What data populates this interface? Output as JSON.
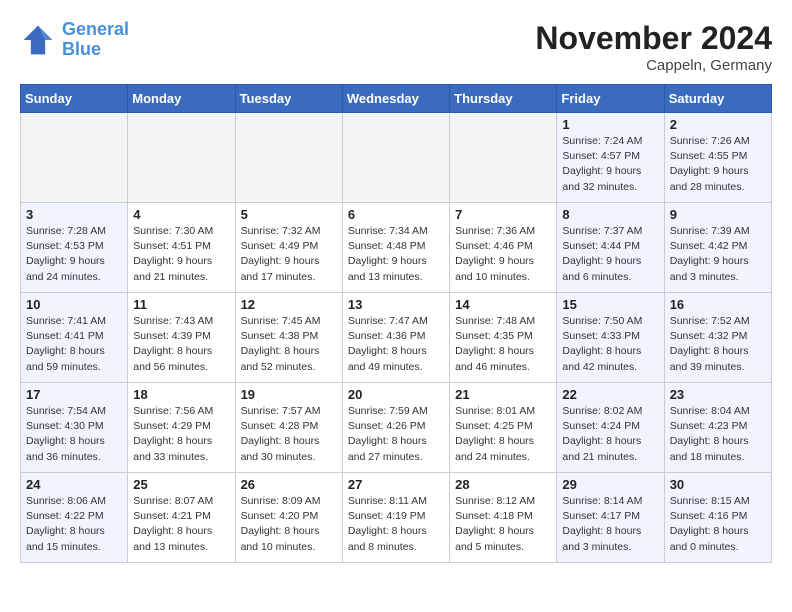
{
  "header": {
    "logo_line1": "General",
    "logo_line2": "Blue",
    "month_title": "November 2024",
    "location": "Cappeln, Germany"
  },
  "weekdays": [
    "Sunday",
    "Monday",
    "Tuesday",
    "Wednesday",
    "Thursday",
    "Friday",
    "Saturday"
  ],
  "weeks": [
    [
      {
        "day": "",
        "info": "",
        "type": "empty"
      },
      {
        "day": "",
        "info": "",
        "type": "empty"
      },
      {
        "day": "",
        "info": "",
        "type": "empty"
      },
      {
        "day": "",
        "info": "",
        "type": "empty"
      },
      {
        "day": "",
        "info": "",
        "type": "empty"
      },
      {
        "day": "1",
        "info": "Sunrise: 7:24 AM\nSunset: 4:57 PM\nDaylight: 9 hours and 32 minutes.",
        "type": "weekend"
      },
      {
        "day": "2",
        "info": "Sunrise: 7:26 AM\nSunset: 4:55 PM\nDaylight: 9 hours and 28 minutes.",
        "type": "weekend"
      }
    ],
    [
      {
        "day": "3",
        "info": "Sunrise: 7:28 AM\nSunset: 4:53 PM\nDaylight: 9 hours and 24 minutes.",
        "type": "weekend"
      },
      {
        "day": "4",
        "info": "Sunrise: 7:30 AM\nSunset: 4:51 PM\nDaylight: 9 hours and 21 minutes.",
        "type": "normal"
      },
      {
        "day": "5",
        "info": "Sunrise: 7:32 AM\nSunset: 4:49 PM\nDaylight: 9 hours and 17 minutes.",
        "type": "normal"
      },
      {
        "day": "6",
        "info": "Sunrise: 7:34 AM\nSunset: 4:48 PM\nDaylight: 9 hours and 13 minutes.",
        "type": "normal"
      },
      {
        "day": "7",
        "info": "Sunrise: 7:36 AM\nSunset: 4:46 PM\nDaylight: 9 hours and 10 minutes.",
        "type": "normal"
      },
      {
        "day": "8",
        "info": "Sunrise: 7:37 AM\nSunset: 4:44 PM\nDaylight: 9 hours and 6 minutes.",
        "type": "weekend"
      },
      {
        "day": "9",
        "info": "Sunrise: 7:39 AM\nSunset: 4:42 PM\nDaylight: 9 hours and 3 minutes.",
        "type": "weekend"
      }
    ],
    [
      {
        "day": "10",
        "info": "Sunrise: 7:41 AM\nSunset: 4:41 PM\nDaylight: 8 hours and 59 minutes.",
        "type": "weekend"
      },
      {
        "day": "11",
        "info": "Sunrise: 7:43 AM\nSunset: 4:39 PM\nDaylight: 8 hours and 56 minutes.",
        "type": "normal"
      },
      {
        "day": "12",
        "info": "Sunrise: 7:45 AM\nSunset: 4:38 PM\nDaylight: 8 hours and 52 minutes.",
        "type": "normal"
      },
      {
        "day": "13",
        "info": "Sunrise: 7:47 AM\nSunset: 4:36 PM\nDaylight: 8 hours and 49 minutes.",
        "type": "normal"
      },
      {
        "day": "14",
        "info": "Sunrise: 7:48 AM\nSunset: 4:35 PM\nDaylight: 8 hours and 46 minutes.",
        "type": "normal"
      },
      {
        "day": "15",
        "info": "Sunrise: 7:50 AM\nSunset: 4:33 PM\nDaylight: 8 hours and 42 minutes.",
        "type": "weekend"
      },
      {
        "day": "16",
        "info": "Sunrise: 7:52 AM\nSunset: 4:32 PM\nDaylight: 8 hours and 39 minutes.",
        "type": "weekend"
      }
    ],
    [
      {
        "day": "17",
        "info": "Sunrise: 7:54 AM\nSunset: 4:30 PM\nDaylight: 8 hours and 36 minutes.",
        "type": "weekend"
      },
      {
        "day": "18",
        "info": "Sunrise: 7:56 AM\nSunset: 4:29 PM\nDaylight: 8 hours and 33 minutes.",
        "type": "normal"
      },
      {
        "day": "19",
        "info": "Sunrise: 7:57 AM\nSunset: 4:28 PM\nDaylight: 8 hours and 30 minutes.",
        "type": "normal"
      },
      {
        "day": "20",
        "info": "Sunrise: 7:59 AM\nSunset: 4:26 PM\nDaylight: 8 hours and 27 minutes.",
        "type": "normal"
      },
      {
        "day": "21",
        "info": "Sunrise: 8:01 AM\nSunset: 4:25 PM\nDaylight: 8 hours and 24 minutes.",
        "type": "normal"
      },
      {
        "day": "22",
        "info": "Sunrise: 8:02 AM\nSunset: 4:24 PM\nDaylight: 8 hours and 21 minutes.",
        "type": "weekend"
      },
      {
        "day": "23",
        "info": "Sunrise: 8:04 AM\nSunset: 4:23 PM\nDaylight: 8 hours and 18 minutes.",
        "type": "weekend"
      }
    ],
    [
      {
        "day": "24",
        "info": "Sunrise: 8:06 AM\nSunset: 4:22 PM\nDaylight: 8 hours and 15 minutes.",
        "type": "weekend"
      },
      {
        "day": "25",
        "info": "Sunrise: 8:07 AM\nSunset: 4:21 PM\nDaylight: 8 hours and 13 minutes.",
        "type": "normal"
      },
      {
        "day": "26",
        "info": "Sunrise: 8:09 AM\nSunset: 4:20 PM\nDaylight: 8 hours and 10 minutes.",
        "type": "normal"
      },
      {
        "day": "27",
        "info": "Sunrise: 8:11 AM\nSunset: 4:19 PM\nDaylight: 8 hours and 8 minutes.",
        "type": "normal"
      },
      {
        "day": "28",
        "info": "Sunrise: 8:12 AM\nSunset: 4:18 PM\nDaylight: 8 hours and 5 minutes.",
        "type": "normal"
      },
      {
        "day": "29",
        "info": "Sunrise: 8:14 AM\nSunset: 4:17 PM\nDaylight: 8 hours and 3 minutes.",
        "type": "weekend"
      },
      {
        "day": "30",
        "info": "Sunrise: 8:15 AM\nSunset: 4:16 PM\nDaylight: 8 hours and 0 minutes.",
        "type": "weekend"
      }
    ]
  ]
}
